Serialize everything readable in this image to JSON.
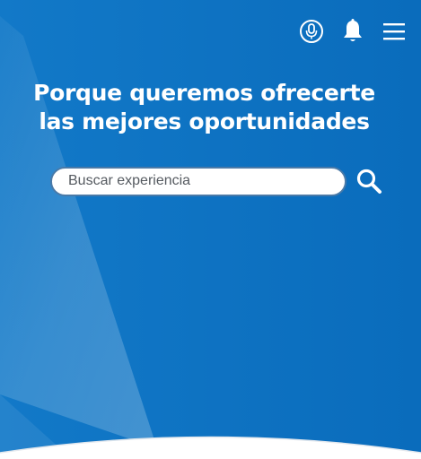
{
  "header": {
    "icons": [
      "microphone-icon",
      "bell-icon",
      "hamburger-menu-icon"
    ]
  },
  "hero": {
    "headline_line1": "Porque queremos ofrecerte",
    "headline_line2": "las mejores oportunidades",
    "background_color": "#0a6fc0"
  },
  "search": {
    "placeholder": "Buscar experiencia",
    "value": "",
    "button_icon": "search-icon"
  }
}
